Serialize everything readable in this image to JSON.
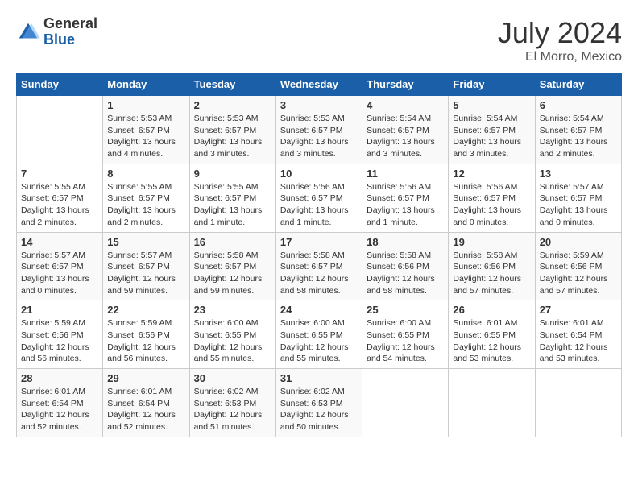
{
  "header": {
    "logo_general": "General",
    "logo_blue": "Blue",
    "title": "July 2024",
    "location": "El Morro, Mexico"
  },
  "columns": [
    "Sunday",
    "Monday",
    "Tuesday",
    "Wednesday",
    "Thursday",
    "Friday",
    "Saturday"
  ],
  "weeks": [
    {
      "days": [
        {
          "num": "",
          "info": ""
        },
        {
          "num": "1",
          "info": "Sunrise: 5:53 AM\nSunset: 6:57 PM\nDaylight: 13 hours\nand 4 minutes."
        },
        {
          "num": "2",
          "info": "Sunrise: 5:53 AM\nSunset: 6:57 PM\nDaylight: 13 hours\nand 3 minutes."
        },
        {
          "num": "3",
          "info": "Sunrise: 5:53 AM\nSunset: 6:57 PM\nDaylight: 13 hours\nand 3 minutes."
        },
        {
          "num": "4",
          "info": "Sunrise: 5:54 AM\nSunset: 6:57 PM\nDaylight: 13 hours\nand 3 minutes."
        },
        {
          "num": "5",
          "info": "Sunrise: 5:54 AM\nSunset: 6:57 PM\nDaylight: 13 hours\nand 3 minutes."
        },
        {
          "num": "6",
          "info": "Sunrise: 5:54 AM\nSunset: 6:57 PM\nDaylight: 13 hours\nand 2 minutes."
        }
      ]
    },
    {
      "days": [
        {
          "num": "7",
          "info": "Sunrise: 5:55 AM\nSunset: 6:57 PM\nDaylight: 13 hours\nand 2 minutes."
        },
        {
          "num": "8",
          "info": "Sunrise: 5:55 AM\nSunset: 6:57 PM\nDaylight: 13 hours\nand 2 minutes."
        },
        {
          "num": "9",
          "info": "Sunrise: 5:55 AM\nSunset: 6:57 PM\nDaylight: 13 hours\nand 1 minute."
        },
        {
          "num": "10",
          "info": "Sunrise: 5:56 AM\nSunset: 6:57 PM\nDaylight: 13 hours\nand 1 minute."
        },
        {
          "num": "11",
          "info": "Sunrise: 5:56 AM\nSunset: 6:57 PM\nDaylight: 13 hours\nand 1 minute."
        },
        {
          "num": "12",
          "info": "Sunrise: 5:56 AM\nSunset: 6:57 PM\nDaylight: 13 hours\nand 0 minutes."
        },
        {
          "num": "13",
          "info": "Sunrise: 5:57 AM\nSunset: 6:57 PM\nDaylight: 13 hours\nand 0 minutes."
        }
      ]
    },
    {
      "days": [
        {
          "num": "14",
          "info": "Sunrise: 5:57 AM\nSunset: 6:57 PM\nDaylight: 13 hours\nand 0 minutes."
        },
        {
          "num": "15",
          "info": "Sunrise: 5:57 AM\nSunset: 6:57 PM\nDaylight: 12 hours\nand 59 minutes."
        },
        {
          "num": "16",
          "info": "Sunrise: 5:58 AM\nSunset: 6:57 PM\nDaylight: 12 hours\nand 59 minutes."
        },
        {
          "num": "17",
          "info": "Sunrise: 5:58 AM\nSunset: 6:57 PM\nDaylight: 12 hours\nand 58 minutes."
        },
        {
          "num": "18",
          "info": "Sunrise: 5:58 AM\nSunset: 6:56 PM\nDaylight: 12 hours\nand 58 minutes."
        },
        {
          "num": "19",
          "info": "Sunrise: 5:58 AM\nSunset: 6:56 PM\nDaylight: 12 hours\nand 57 minutes."
        },
        {
          "num": "20",
          "info": "Sunrise: 5:59 AM\nSunset: 6:56 PM\nDaylight: 12 hours\nand 57 minutes."
        }
      ]
    },
    {
      "days": [
        {
          "num": "21",
          "info": "Sunrise: 5:59 AM\nSunset: 6:56 PM\nDaylight: 12 hours\nand 56 minutes."
        },
        {
          "num": "22",
          "info": "Sunrise: 5:59 AM\nSunset: 6:56 PM\nDaylight: 12 hours\nand 56 minutes."
        },
        {
          "num": "23",
          "info": "Sunrise: 6:00 AM\nSunset: 6:55 PM\nDaylight: 12 hours\nand 55 minutes."
        },
        {
          "num": "24",
          "info": "Sunrise: 6:00 AM\nSunset: 6:55 PM\nDaylight: 12 hours\nand 55 minutes."
        },
        {
          "num": "25",
          "info": "Sunrise: 6:00 AM\nSunset: 6:55 PM\nDaylight: 12 hours\nand 54 minutes."
        },
        {
          "num": "26",
          "info": "Sunrise: 6:01 AM\nSunset: 6:55 PM\nDaylight: 12 hours\nand 53 minutes."
        },
        {
          "num": "27",
          "info": "Sunrise: 6:01 AM\nSunset: 6:54 PM\nDaylight: 12 hours\nand 53 minutes."
        }
      ]
    },
    {
      "days": [
        {
          "num": "28",
          "info": "Sunrise: 6:01 AM\nSunset: 6:54 PM\nDaylight: 12 hours\nand 52 minutes."
        },
        {
          "num": "29",
          "info": "Sunrise: 6:01 AM\nSunset: 6:54 PM\nDaylight: 12 hours\nand 52 minutes."
        },
        {
          "num": "30",
          "info": "Sunrise: 6:02 AM\nSunset: 6:53 PM\nDaylight: 12 hours\nand 51 minutes."
        },
        {
          "num": "31",
          "info": "Sunrise: 6:02 AM\nSunset: 6:53 PM\nDaylight: 12 hours\nand 50 minutes."
        },
        {
          "num": "",
          "info": ""
        },
        {
          "num": "",
          "info": ""
        },
        {
          "num": "",
          "info": ""
        }
      ]
    }
  ]
}
